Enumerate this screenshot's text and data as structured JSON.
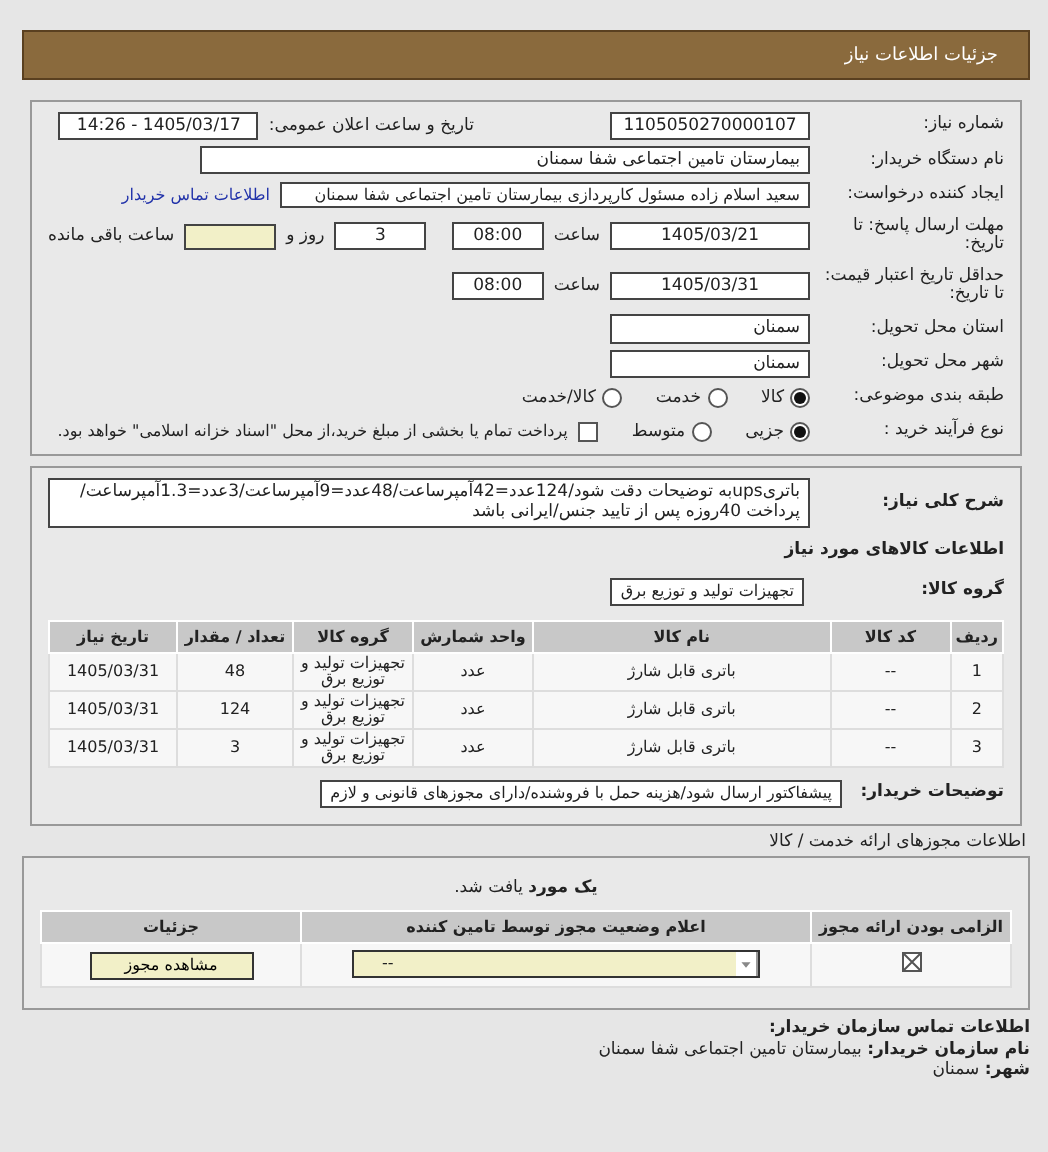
{
  "header": {
    "title": "جزئیات اطلاعات نیاز"
  },
  "need_number": {
    "label": "شماره نیاز:",
    "value": "1105050270000107"
  },
  "announce": {
    "label": "تاریخ و ساعت اعلان عمومی:",
    "value": "1405/03/17 - 14:26"
  },
  "buyer": {
    "label": "نام دستگاه خریدار:",
    "value": "بیمارستان تامین اجتماعی شفا سمنان"
  },
  "creator": {
    "label": "ایجاد کننده درخواست:",
    "value": "سعید اسلام زاده مسئول کارپردازی بیمارستان تامین اجتماعی شفا سمنان",
    "link": "اطلاعات تماس خریدار"
  },
  "deadline": {
    "label": "مهلت ارسال پاسخ: تا تاریخ:",
    "date": "1405/03/21",
    "time_label": "ساعت",
    "time": "08:00",
    "days": "3",
    "days_label": "روز و",
    "hours_label": "ساعت باقی مانده"
  },
  "validity": {
    "label": "حداقل تاریخ اعتبار قیمت: تا تاریخ:",
    "date": "1405/03/31",
    "time_label": "ساعت",
    "time": "08:00"
  },
  "province": {
    "label": "استان محل تحویل:",
    "value": "سمنان"
  },
  "city": {
    "label": "شهر محل تحویل:",
    "value": "سمنان"
  },
  "category": {
    "label": "طبقه بندی موضوعی:",
    "options": [
      {
        "label": "کالا",
        "selected": true
      },
      {
        "label": "خدمت",
        "selected": false
      },
      {
        "label": "کالا/خدمت",
        "selected": false
      }
    ]
  },
  "process": {
    "label": "نوع فرآیند خرید :",
    "options": [
      {
        "label": "جزیی",
        "selected": true
      },
      {
        "label": "متوسط",
        "selected": false
      }
    ],
    "payment": {
      "checked": false,
      "text": "پرداخت تمام یا بخشی از مبلغ خرید،از محل \"اسناد خزانه اسلامی\" خواهد بود."
    }
  },
  "description": {
    "label": "شرح کلی نیاز:",
    "value": "باتریupsبه توضیحات دقت شود/124عدد=42آمپرساعت/48عدد=9آمپرساعت/3عدد=1.3آمپرساعت/پرداخت 40روزه پس از تایید جنس/ایرانی باشد"
  },
  "goods": {
    "title": "اطلاعات کالاهای مورد نیاز",
    "group_label": "گروه کالا:",
    "group": "تجهیزات تولید و توزیع برق",
    "columns": [
      "ردیف",
      "کد کالا",
      "نام کالا",
      "واحد شمارش",
      "گروه کالا",
      "تعداد / مقدار",
      "تاریخ نیاز"
    ],
    "rows": [
      [
        "1",
        "--",
        "باتری قابل شارژ",
        "عدد",
        "تجهیزات تولید و توزیع برق",
        "48",
        "1405/03/31"
      ],
      [
        "2",
        "--",
        "باتری قابل شارژ",
        "عدد",
        "تجهیزات تولید و توزیع برق",
        "124",
        "1405/03/31"
      ],
      [
        "3",
        "--",
        "باتری قابل شارژ",
        "عدد",
        "تجهیزات تولید و توزیع برق",
        "3",
        "1405/03/31"
      ]
    ]
  },
  "notes": {
    "label": "توضیحات خریدار:",
    "value": "پیشفاکتور ارسال شود/هزینه حمل با فروشنده/دارای مجوزهای قانونی و لازم"
  },
  "license": {
    "title": "اطلاعات مجوزهای ارائه خدمت / کالا",
    "found": "**یک مورد** یافت شد.",
    "columns": [
      "الزامی بودن ارائه مجوز",
      "اعلام وضعیت مجوز توسط تامین کننده",
      "جزئیات"
    ],
    "rows": [
      {
        "mandatory": true,
        "status": "--",
        "button": "مشاهده مجوز"
      }
    ]
  },
  "contact": {
    "title": "اطلاعات تماس سازمان خریدار:",
    "lines": [
      {
        "label": "نام سازمان خریدار:",
        "value": "بیمارستان تامین اجتماعی شفا سمنان"
      },
      {
        "label": "شهر:",
        "value": "سمنان"
      }
    ]
  }
}
